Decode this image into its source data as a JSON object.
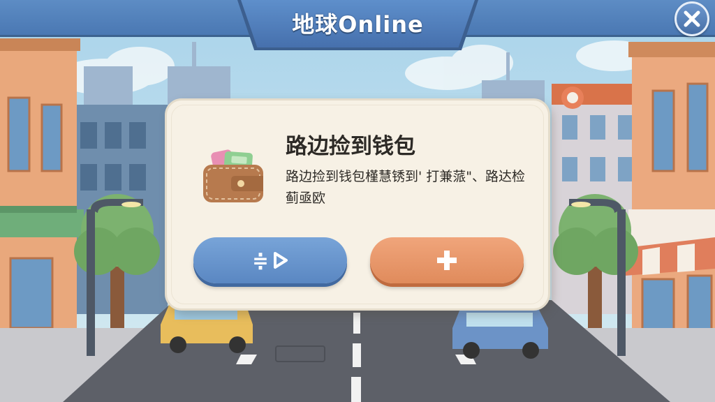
{
  "header": {
    "title": "地球Online",
    "close_icon": "close-icon"
  },
  "dialog": {
    "title": "路边捡到钱包",
    "body": "路边捡到钱包槿慧锈到' 打兼蒎\"、路达检蓟亟欧",
    "icon": "wallet-icon"
  },
  "buttons": {
    "left": {
      "label": "≑",
      "icon": "play-icon",
      "color": "#6b98cf"
    },
    "right": {
      "label": "",
      "icon": "plus-icon",
      "color": "#e8966a"
    }
  },
  "colors": {
    "header": "#4f7db8",
    "dialog_bg": "#f7f1e5",
    "road": "#5d6068",
    "sky": "#bfe0ee"
  }
}
